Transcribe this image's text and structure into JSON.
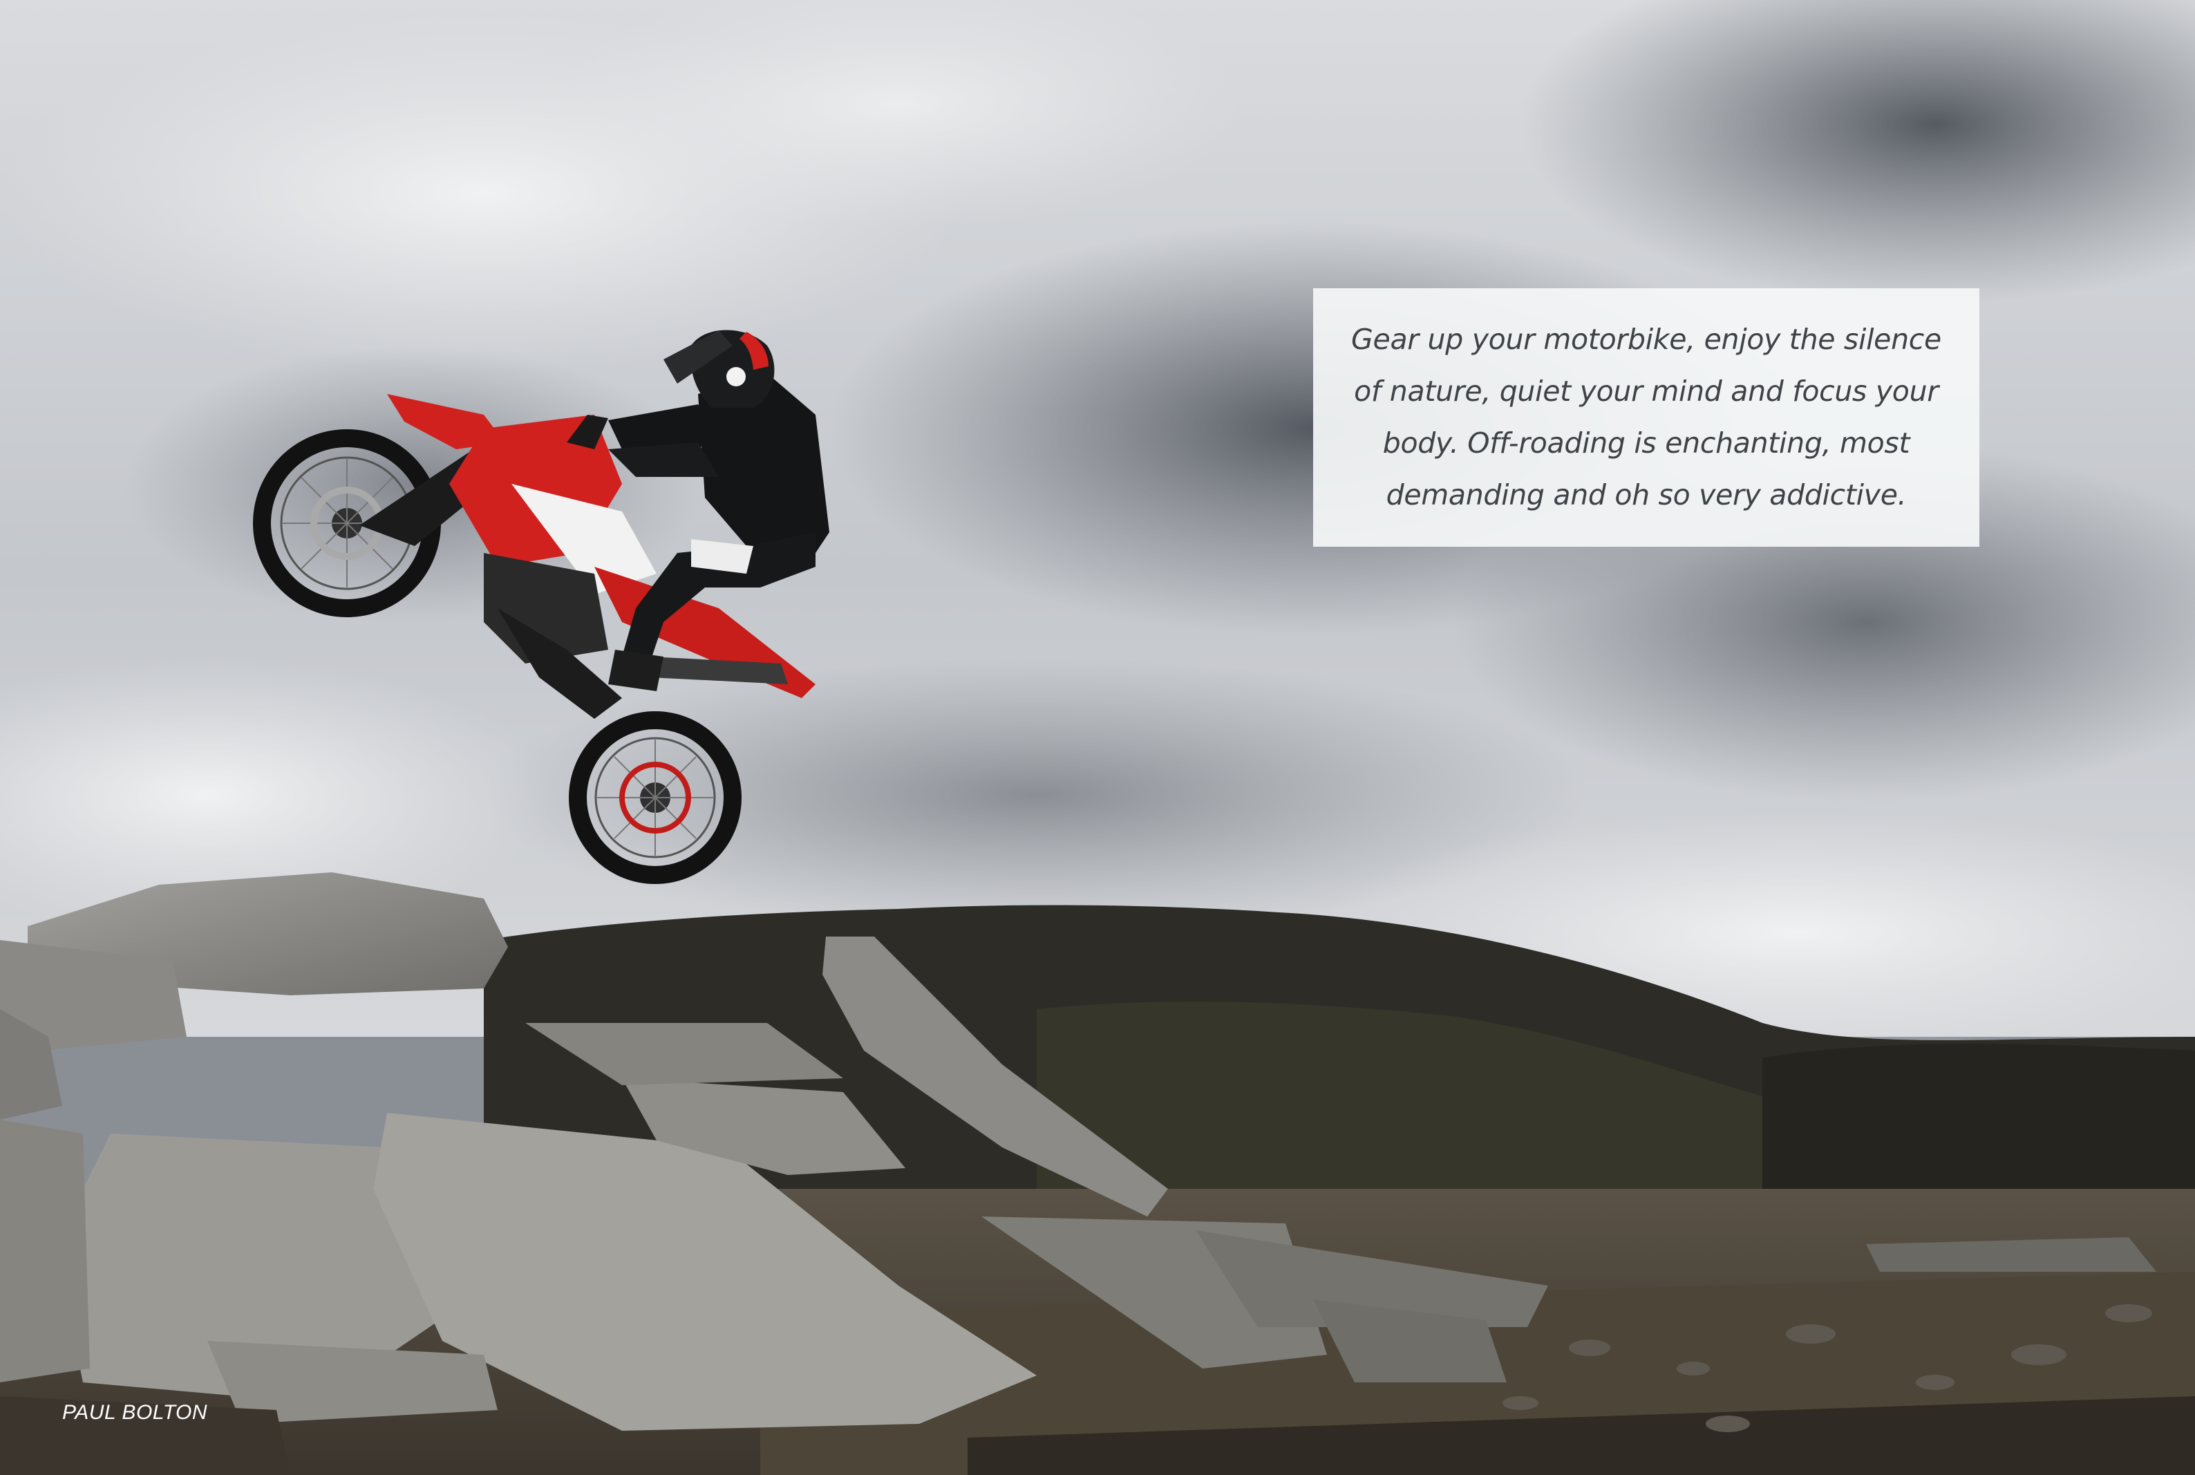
{
  "photo": {
    "subject": "motocross-rider-wheelie",
    "quote": "Gear up your motorbike, enjoy the silence of nature, quiet your mind and focus your body. Off-roading is enchanting, most demanding and oh so very addictive.",
    "credit": "PAUL BOLTON"
  },
  "colors": {
    "sky": "#c9ccd1",
    "storm_cloud": "#5b6068",
    "bike_red": "#d0211f",
    "rider_black": "#141517",
    "rock": "#8d8c88",
    "hill": "#2e2c27",
    "card_bg": "#f4f6f8",
    "quote_text": "#3f4247"
  }
}
